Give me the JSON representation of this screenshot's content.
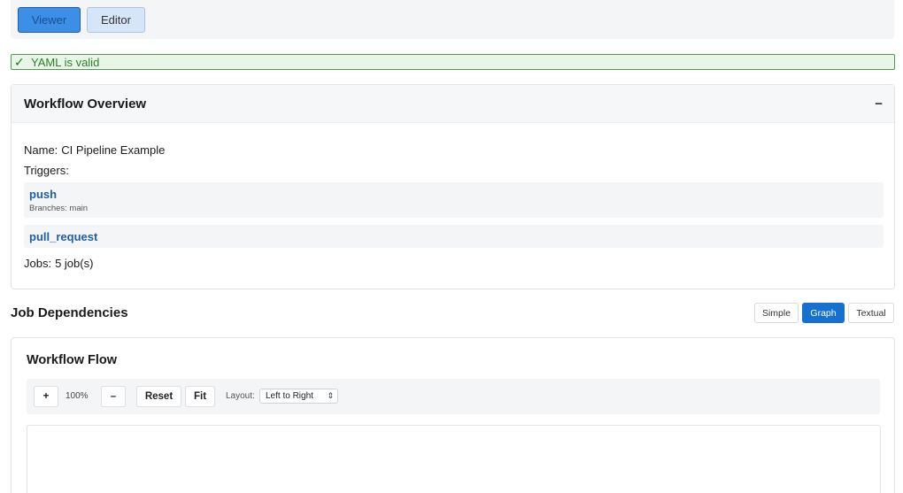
{
  "modes": {
    "viewer": "Viewer",
    "editor": "Editor"
  },
  "validation": {
    "check": "✓",
    "message": "YAML is valid",
    "color": "#2f7d2f"
  },
  "overview": {
    "title": "Workflow Overview",
    "collapse_icon": "−",
    "name_label": "Name:",
    "name_value": "CI Pipeline Example",
    "triggers_label": "Triggers:",
    "triggers": [
      {
        "name": "push",
        "detail": "Branches: main"
      },
      {
        "name": "pull_request"
      }
    ],
    "jobs_label": "Jobs:",
    "jobs_value": "5 job(s)"
  },
  "dependencies": {
    "title": "Job Dependencies",
    "views": [
      "Simple",
      "Graph",
      "Textual"
    ],
    "active_view": "Graph"
  },
  "flow": {
    "title": "Workflow Flow",
    "zoom_in": "+",
    "zoom_level": "100%",
    "zoom_out": "–",
    "reset": "Reset",
    "fit": "Fit",
    "layout_label": "Layout:",
    "layout_value": "Left to Right"
  },
  "colors": {
    "accent": "#1670d0",
    "link": "#1f5fa0",
    "valid_border": "#4f9a4f"
  }
}
